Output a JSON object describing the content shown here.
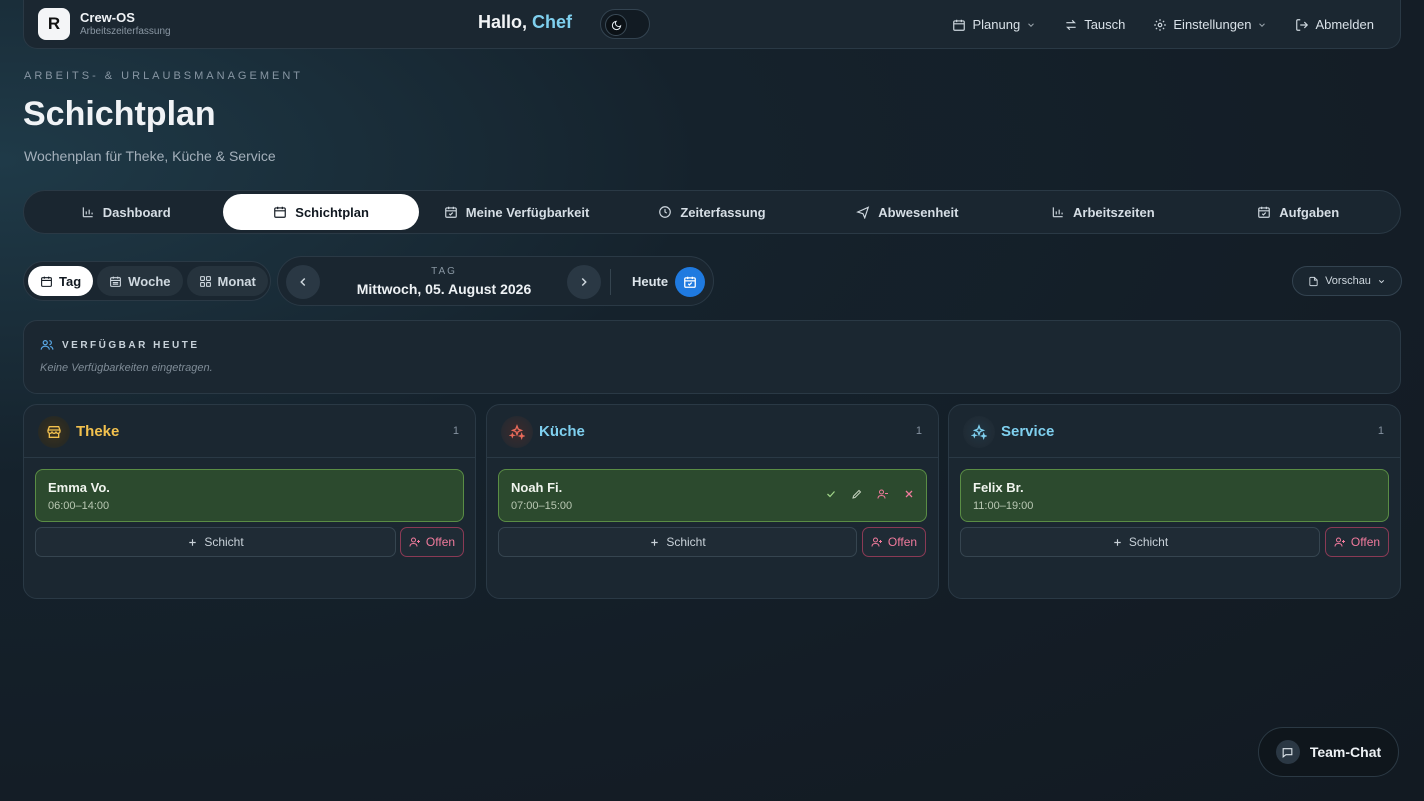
{
  "app": {
    "logo_letter": "R",
    "name": "Crew-OS",
    "subtitle": "Arbeitszeiterfassung"
  },
  "greeting": {
    "prefix": "Hallo, ",
    "name": "Chef"
  },
  "nav": {
    "planning": "Planung",
    "swap": "Tausch",
    "settings": "Einstellungen",
    "logout": "Abmelden"
  },
  "header": {
    "eyebrow": "ARBEITS- & URLAUBSMANAGEMENT",
    "title": "Schichtplan",
    "subtitle": "Wochenplan für Theke, Küche & Service"
  },
  "tabs": [
    {
      "label": "Dashboard",
      "icon": "bar-chart-icon"
    },
    {
      "label": "Schichtplan",
      "icon": "calendar-icon",
      "active": true
    },
    {
      "label": "Meine Verfügbarkeit",
      "icon": "calendar-check-icon"
    },
    {
      "label": "Zeiterfassung",
      "icon": "clock-icon"
    },
    {
      "label": "Abwesenheit",
      "icon": "plane-icon"
    },
    {
      "label": "Arbeitszeiten",
      "icon": "bar-chart-icon"
    },
    {
      "label": "Aufgaben",
      "icon": "calendar-check-icon"
    }
  ],
  "views": {
    "day": "Tag",
    "week": "Woche",
    "month": "Monat",
    "active": "day"
  },
  "date": {
    "label": "TAG",
    "value": "Mittwoch, 05. August 2026",
    "today": "Heute"
  },
  "preview": {
    "label": "Vorschau"
  },
  "availability": {
    "title": "VERFÜGBAR HEUTE",
    "empty": "Keine Verfügbarkeiten eingetragen."
  },
  "columns": [
    {
      "title": "Theke",
      "count": "1",
      "color": "#f2c14e",
      "icon": "store-icon",
      "shift": {
        "name": "Emma Vo.",
        "time": "06:00–14:00"
      }
    },
    {
      "title": "Küche",
      "count": "1",
      "color": "#7fd0ef",
      "icon": "sparkles-icon",
      "shift": {
        "name": "Noah Fi.",
        "time": "07:00–15:00"
      }
    },
    {
      "title": "Service",
      "count": "1",
      "color": "#7fd0ef",
      "icon": "sparkles-icon",
      "shift": {
        "name": "Felix Br.",
        "time": "11:00–19:00"
      }
    }
  ],
  "buttons": {
    "add_shift": "Schicht",
    "open": "Offen"
  },
  "chat": {
    "label": "Team-Chat"
  },
  "colors": {
    "accent": "#1f7ae0",
    "shift_bg": "#2c4a2e",
    "shift_border": "#5a8d45",
    "open": "#f07a9c"
  }
}
